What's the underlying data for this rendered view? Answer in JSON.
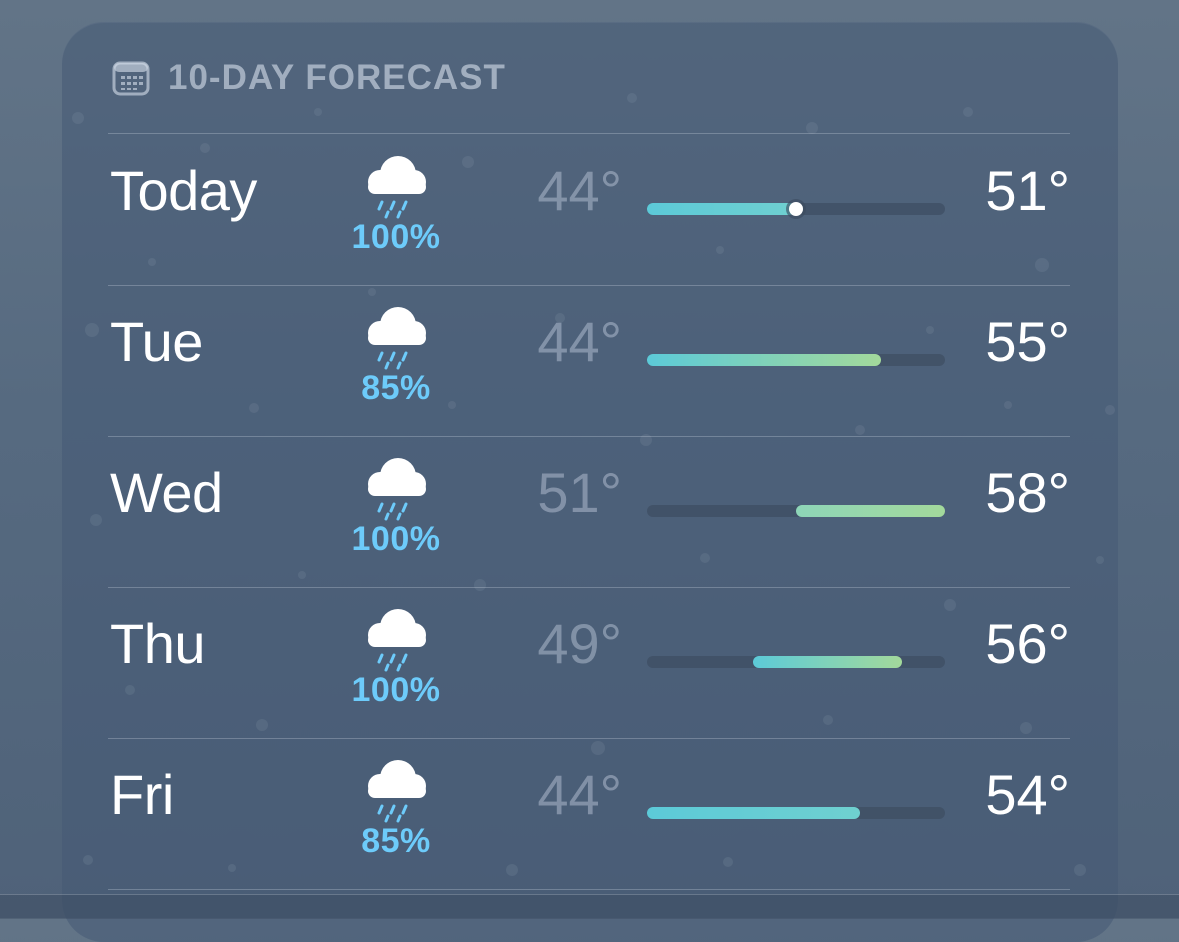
{
  "section": {
    "title": "10-DAY FORECAST",
    "icon": "calendar-icon"
  },
  "colors": {
    "precip": "#6dcbfa",
    "bar_cool": "#5ccad8",
    "bar_warm": "#a3d99b",
    "low_temp": "rgba(205,215,230,0.42)",
    "high_temp": "#ffffff"
  },
  "range": {
    "min": 44,
    "max": 58
  },
  "days": [
    {
      "label": "Today",
      "icon": "cloud-rain-icon",
      "precip": "100%",
      "low_label": "44°",
      "high_label": "51°",
      "low": 44,
      "high": 51,
      "current": 51
    },
    {
      "label": "Tue",
      "icon": "cloud-rain-icon",
      "precip": "85%",
      "low_label": "44°",
      "high_label": "55°",
      "low": 44,
      "high": 55
    },
    {
      "label": "Wed",
      "icon": "cloud-rain-icon",
      "precip": "100%",
      "low_label": "51°",
      "high_label": "58°",
      "low": 51,
      "high": 58
    },
    {
      "label": "Thu",
      "icon": "cloud-rain-icon",
      "precip": "100%",
      "low_label": "49°",
      "high_label": "56°",
      "low": 49,
      "high": 56
    },
    {
      "label": "Fri",
      "icon": "cloud-rain-icon",
      "precip": "85%",
      "low_label": "44°",
      "high_label": "54°",
      "low": 44,
      "high": 54
    }
  ]
}
